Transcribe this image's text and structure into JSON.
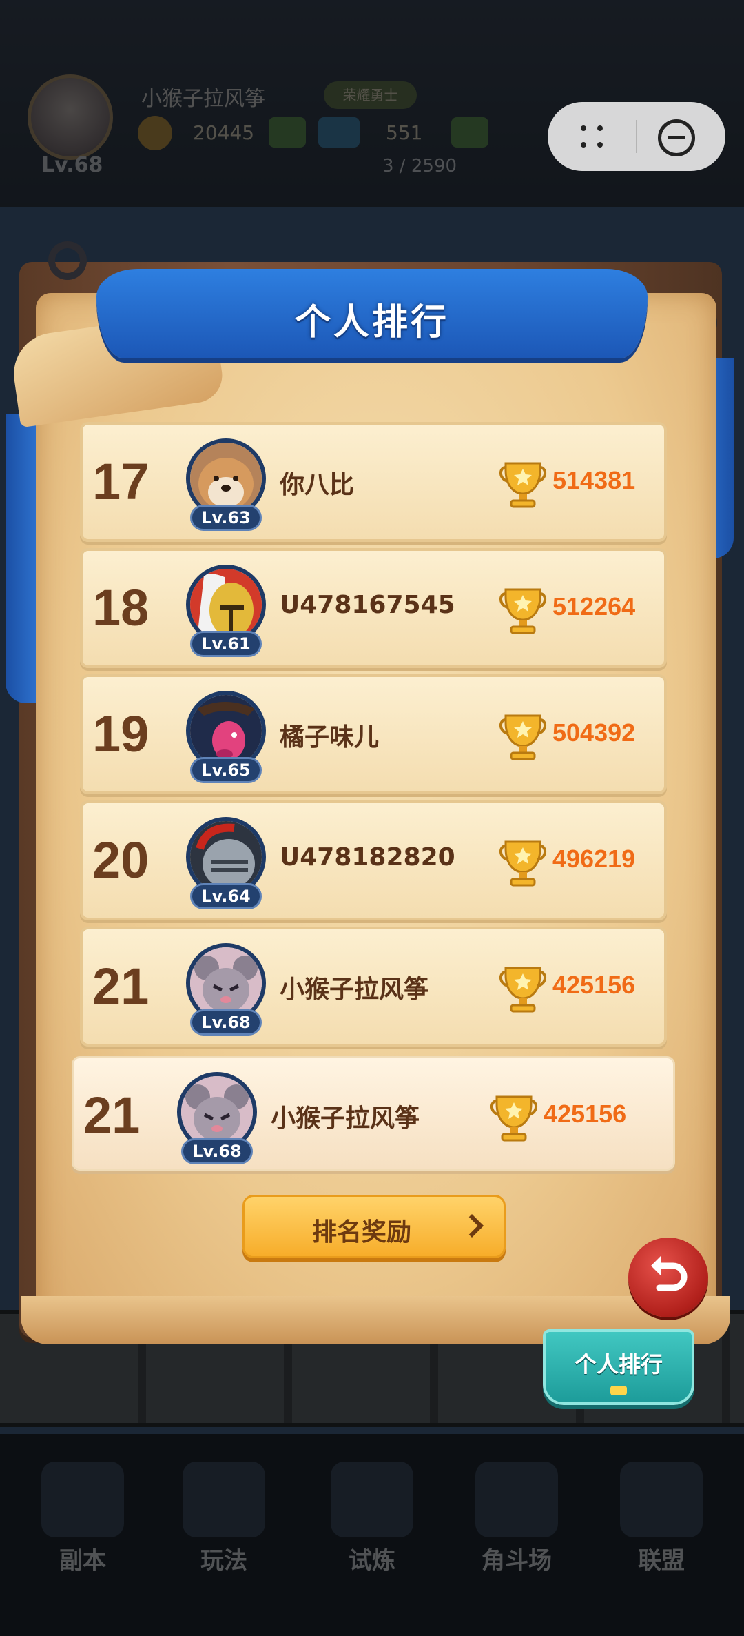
{
  "background": {
    "player_name": "小猴子拉风筝",
    "badge": "荣耀勇士",
    "level": "Lv.68",
    "coins": "20445",
    "gems": "551",
    "stamina": "3 / 2590",
    "nav": [
      "副本",
      "玩法",
      "试炼",
      "角斗场",
      "联盟"
    ]
  },
  "panel": {
    "title": "个人排行"
  },
  "rankings": [
    {
      "rank": "17",
      "level": "Lv.63",
      "name": "你八比",
      "score": "514381",
      "avatar": "shiba-dog"
    },
    {
      "rank": "18",
      "level": "Lv.61",
      "name": "U478167545",
      "score": "512264",
      "avatar": "gold-knight"
    },
    {
      "rank": "19",
      "level": "Lv.65",
      "name": "橘子味儿",
      "score": "504392",
      "avatar": "pink-deer"
    },
    {
      "rank": "20",
      "level": "Lv.64",
      "name": "U478182820",
      "score": "496219",
      "avatar": "iron-helmet"
    },
    {
      "rank": "21",
      "level": "Lv.68",
      "name": "小猴子拉风筝",
      "score": "425156",
      "avatar": "grey-mouse"
    }
  ],
  "my_rank": {
    "rank": "21",
    "level": "Lv.68",
    "name": "小猴子拉风筝",
    "score": "425156",
    "avatar": "grey-mouse"
  },
  "buttons": {
    "reward": "排名奖励",
    "tab": "个人排行"
  },
  "colors": {
    "rank_text": "#6b3e1f",
    "score_text": "#f06b16",
    "ribbon": "#2e7fe0",
    "reward_button": "#f7ad2a",
    "tab": "#1d9c9a"
  }
}
